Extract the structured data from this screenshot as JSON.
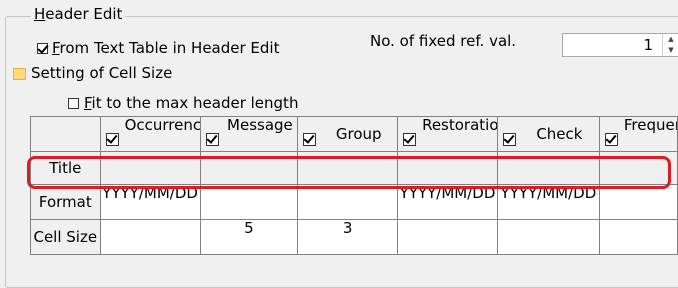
{
  "group": {
    "legend_underlined": "H",
    "legend_rest": "eader Edit"
  },
  "from_text_table": {
    "checked": true,
    "label_underlined": "F",
    "label_rest": "rom Text Table in Header Edit"
  },
  "fixed_ref": {
    "label": "No. of fixed ref. val.",
    "value": "1"
  },
  "cell_size": {
    "label": "Setting of Cell Size",
    "icon": "folder-icon"
  },
  "fit_max": {
    "checked": false,
    "label_underlined": "F",
    "label_rest": "it to the max header length"
  },
  "grid": {
    "columns": [
      {
        "label": "Occurrence",
        "checked": true
      },
      {
        "label": "Message",
        "checked": true
      },
      {
        "label": "Group",
        "checked": true
      },
      {
        "label": "Restoration",
        "checked": true
      },
      {
        "label": "Check",
        "checked": true
      },
      {
        "label": "Frequency",
        "checked": true
      }
    ],
    "rows": [
      {
        "header": "Title",
        "cells": [
          "",
          "",
          "",
          "",
          "",
          ""
        ]
      },
      {
        "header": "Format",
        "cells": [
          "YYYY/MM/DD",
          "",
          "",
          "YYYY/MM/DD",
          "YYYY/MM/DD",
          ""
        ]
      },
      {
        "header": "Cell Size",
        "cells": [
          "",
          "5",
          "3",
          "",
          "",
          ""
        ]
      }
    ]
  },
  "colors": {
    "highlight": "#e01b22",
    "folder": "#ffd978"
  }
}
